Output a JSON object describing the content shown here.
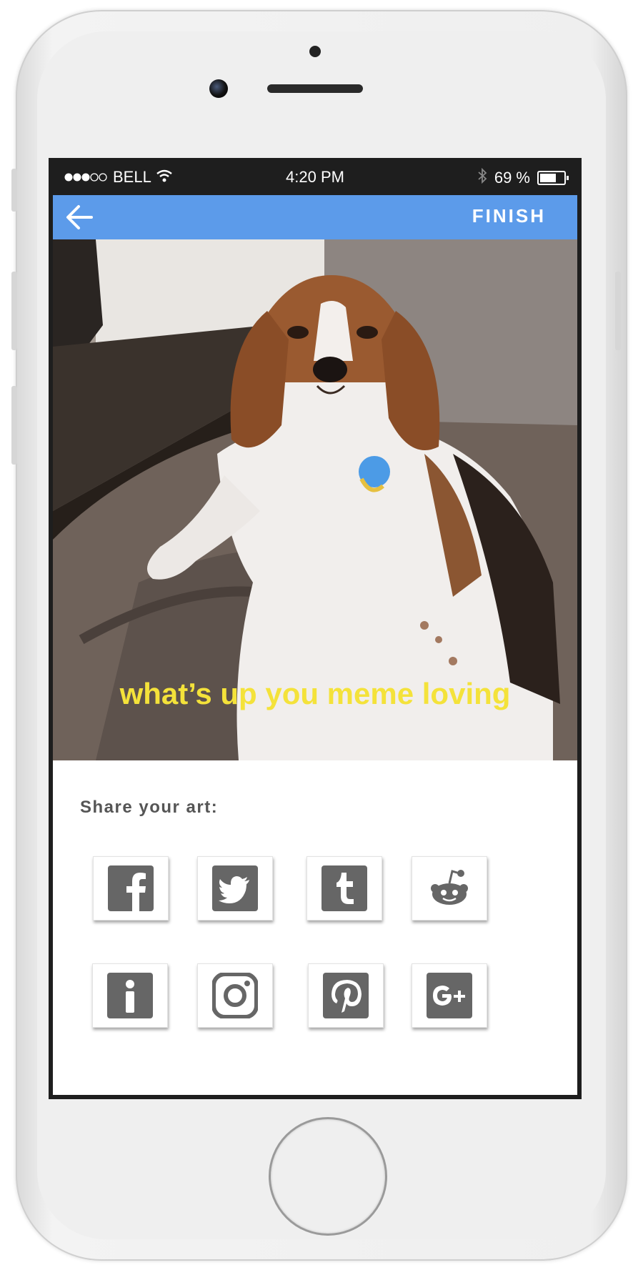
{
  "status_bar": {
    "carrier": "BELL",
    "time": "4:20 PM",
    "battery_percent": "69 %",
    "battery_level": 0.69
  },
  "app_bar": {
    "action_label": "FINISH",
    "color": "#5c9bea"
  },
  "meme": {
    "caption": "what’s up you meme loving",
    "caption_color": "#f4e23a"
  },
  "share": {
    "title": "Share your art:",
    "buttons": [
      {
        "icon": "facebook-icon"
      },
      {
        "icon": "twitter-icon"
      },
      {
        "icon": "tumblr-icon"
      },
      {
        "icon": "reddit-icon"
      },
      {
        "icon": "info-icon"
      },
      {
        "icon": "instagram-icon"
      },
      {
        "icon": "pinterest-icon"
      },
      {
        "icon": "google-plus-icon"
      }
    ]
  }
}
